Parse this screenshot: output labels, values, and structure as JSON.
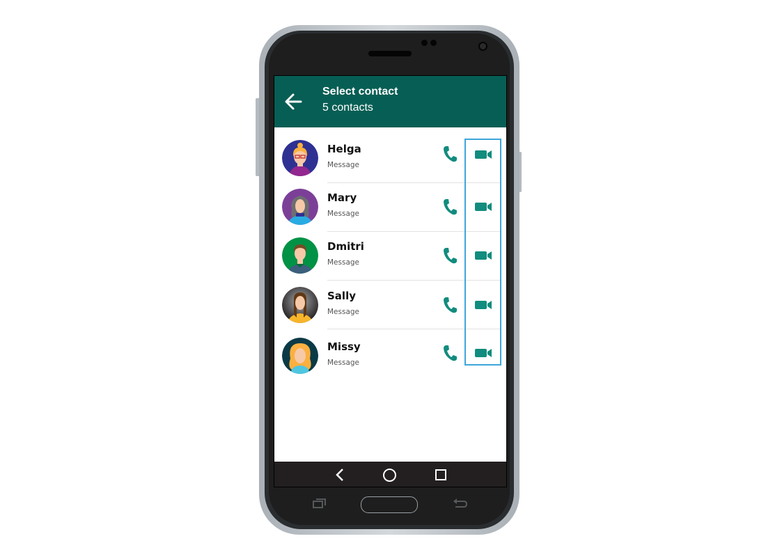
{
  "header": {
    "title": "Select contact",
    "subtitle": "5 contacts"
  },
  "contacts": [
    {
      "name": "Helga",
      "subtitle": "Message"
    },
    {
      "name": "Mary",
      "subtitle": "Message"
    },
    {
      "name": "Dmitri",
      "subtitle": "Message"
    },
    {
      "name": "Sally",
      "subtitle": "Message"
    },
    {
      "name": "Missy",
      "subtitle": "Message"
    }
  ],
  "icons": {
    "back": "arrow-left-icon",
    "call": "phone-icon",
    "video": "video-camera-icon",
    "nav_back": "chevron-left-icon",
    "nav_home": "circle-home-icon",
    "nav_recent": "square-recent-icon"
  },
  "colors": {
    "appbar": "#075e54",
    "accent": "#128c7e",
    "highlight": "#3da6db"
  }
}
